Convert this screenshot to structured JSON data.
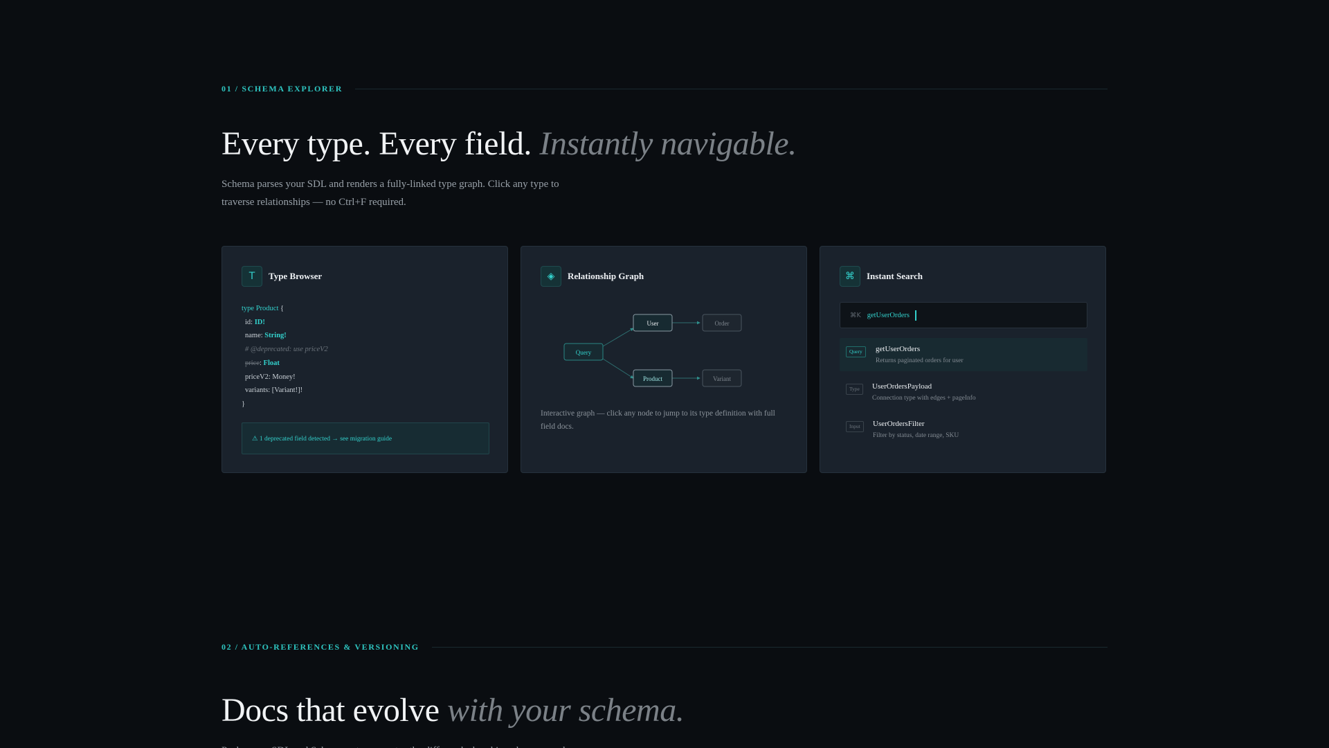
{
  "section1": {
    "eyebrow": "01 / SCHEMA EXPLORER",
    "headline_main": "Every type. Every field.",
    "headline_accent": "Instantly navigable.",
    "lede": "Schema parses your SDL and renders a fully-linked type graph. Click any type to traverse relationships — no Ctrl+F required."
  },
  "cards": {
    "type_browser": {
      "icon_glyph": "T",
      "icon": "type-icon",
      "title": "Type Browser",
      "code": {
        "l1_kw": "type",
        "l1_name": "Product",
        "l1_brace": "{",
        "l2_field": "id:",
        "l2_type": "ID!",
        "l3_field": "name:",
        "l3_type": "String!",
        "l4_comment": "# @deprecated: use priceV2",
        "l5_field": "price",
        "l5_colon": ":",
        "l5_type": "Float",
        "l6_field": "priceV2:",
        "l6_type": "Money!",
        "l7_field": "variants:",
        "l7_type": "[Variant!]!",
        "l8_brace": "}"
      },
      "warning": "⚠ 1 deprecated field detected → see migration guide"
    },
    "relationship_graph": {
      "icon_glyph": "◈",
      "icon": "graph-icon",
      "title": "Relationship Graph",
      "nodes": {
        "query": "Query",
        "user": "User",
        "order": "Order",
        "product": "Product",
        "variant": "Variant"
      },
      "note": "Interactive graph — click any node to jump to its type definition with full field docs."
    },
    "instant_search": {
      "icon_glyph": "⌘",
      "icon": "command-icon",
      "title": "Instant Search",
      "shortcut": "⌘K",
      "query": "getUserOrders",
      "results": [
        {
          "tag": "Query",
          "name": "getUserOrders",
          "desc": "Returns paginated orders for user"
        },
        {
          "tag": "Type",
          "name": "UserOrdersPayload",
          "desc": "Connection type with edges + pageInfo"
        },
        {
          "tag": "Input",
          "name": "UserOrdersFilter",
          "desc": "Filter by status, date range, SKU"
        }
      ]
    }
  },
  "section2": {
    "eyebrow": "02 / AUTO-REFERENCES & VERSIONING",
    "headline_main": "Docs that evolve",
    "headline_accent": "with your schema.",
    "lede": "Push a new SDL and Schema auto-generates the diff, marks breaking changes, and"
  },
  "colors": {
    "background": "#0a0d11",
    "card": "#1a222c",
    "accent": "#33d1cc",
    "muted": "#7b8187"
  }
}
